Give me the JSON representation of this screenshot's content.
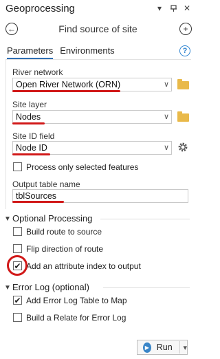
{
  "pane": {
    "title": "Geoprocessing"
  },
  "tool": {
    "title": "Find source of site"
  },
  "tabs": [
    {
      "label": "Parameters"
    },
    {
      "label": "Environments"
    }
  ],
  "params": {
    "river_network": {
      "label": "River network",
      "value": "Open River Network (ORN)"
    },
    "site_layer": {
      "label": "Site layer",
      "value": "Nodes"
    },
    "site_id_field": {
      "label": "Site ID field",
      "value": "Node ID"
    },
    "process_selected": {
      "label": "Process only selected features",
      "checked": false
    },
    "output_table": {
      "label": "Output table name",
      "value": "tblSources"
    }
  },
  "optional_processing": {
    "header": "Optional Processing",
    "items": [
      {
        "label": "Build route to source",
        "checked": false
      },
      {
        "label": "Flip direction of route",
        "checked": false
      },
      {
        "label": "Add an attribute index to output",
        "checked": true
      }
    ]
  },
  "error_log": {
    "header": "Error Log (optional)",
    "items": [
      {
        "label": "Add Error Log Table to Map",
        "checked": true
      },
      {
        "label": "Build a Relate for Error Log",
        "checked": false
      }
    ]
  },
  "run": {
    "label": "Run"
  },
  "colors": {
    "annotation_red": "#d11818",
    "accent_blue": "#2f6fb3",
    "folder_yellow": "#e9b949"
  },
  "icons": [
    "chevron-down-icon",
    "pin-icon",
    "close-icon",
    "back-arrow-icon",
    "add-circle-icon",
    "help-icon",
    "folder-icon",
    "gear-icon",
    "play-icon"
  ]
}
